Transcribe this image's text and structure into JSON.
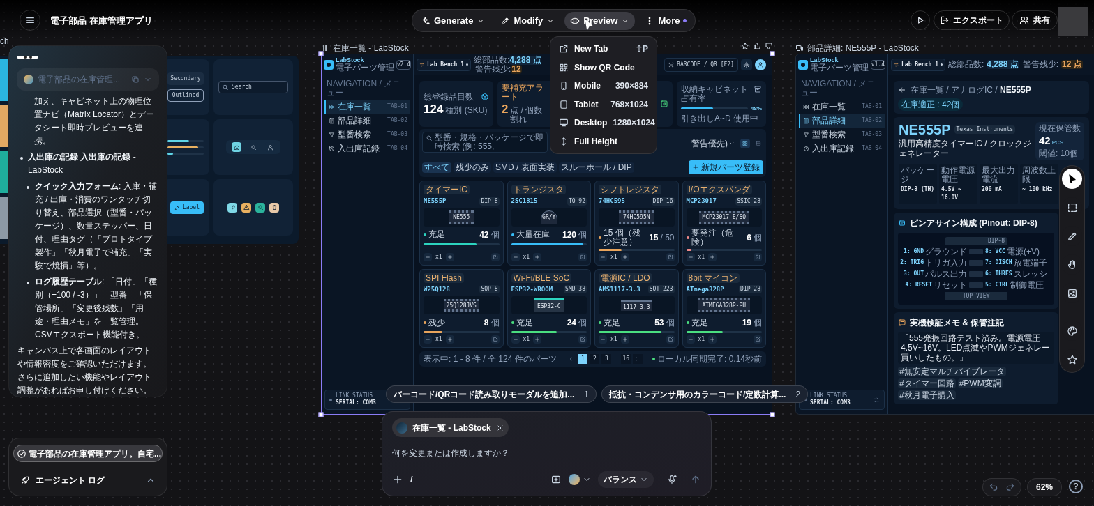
{
  "top_bar": {
    "title": "電子部品 在庫管理アプリ",
    "modes": [
      {
        "label": "Generate",
        "kind": "sparkle",
        "selected": false
      },
      {
        "label": "Modify",
        "kind": "pencil",
        "selected": false
      },
      {
        "label": "Preview",
        "kind": "eye",
        "selected": true
      },
      {
        "label": "More",
        "kind": "more",
        "selected": false
      }
    ],
    "export": "エクスポート",
    "share": "共有"
  },
  "preview_menu": [
    {
      "label": "New Tab",
      "kind": "new-tab",
      "shortcut": "⇧P"
    },
    {
      "label": "Show QR Code",
      "kind": "qr"
    },
    {
      "label": "Mobile",
      "kind": "mobile",
      "size": "390×884"
    },
    {
      "label": "Tablet",
      "kind": "tablet",
      "size": "768×1024"
    },
    {
      "label": "Desktop",
      "kind": "desktop",
      "size": "1280×1024"
    },
    {
      "label": "Full Height",
      "kind": "height"
    }
  ],
  "chat": {
    "collapsed_message": "電子部品の在庫管理...",
    "continuation": "加え、キャビネット上の物理位置ナビ（Matrix Locator）とデータシート即時プレビューを連携。",
    "bullets": [
      {
        "text": "**入出庫の記録 入出庫の記録** - LabStock",
        "children": [
          {
            "text": "**クイック入力フォーム**: 入庫・補充 / 出庫・消費のワンタッチ切り替え、部品選択（型番・パッケージ）、数量ステッパー、日付、理由タグ（「プロトタイプ製作」「秋月電子で補充」「実験で焼損」等）。"
          },
          {
            "text": "**ログ履歴テーブル**: 「日付」「種別（+100 / -3）」「型番」「保管場所」「変更後残数」「用途・理由メモ」を一覧管理。CSVエクスポート機能付き。"
          }
        ]
      }
    ],
    "closing": "キャンバス上で各画面のレイアウトや情報密度をご確認いただけます。さらに追加したい機能やレイアウト調整があればお申し付けください。"
  },
  "task": {
    "label": "電子部品の在庫管理アプリ。自宅..."
  },
  "agent_log": {
    "label": "エージェント ログ",
    "expanded": true
  },
  "design_frame": {
    "title": "ch",
    "swatches": [
      {
        "color": "#2bb5df"
      },
      {
        "color": "#e2a862"
      },
      {
        "color": "#1fae9c"
      },
      {
        "color": "#8d99a5"
      }
    ],
    "buttons": [
      "Secondary",
      "Outlined"
    ],
    "search_placeholder": "Search",
    "bars": [
      {
        "level": 0.6,
        "color": "#5fd4e6"
      },
      {
        "level": 0.85,
        "color": "#e8b060"
      },
      {
        "level": 0.15,
        "color": "#5fd4e6"
      }
    ],
    "nav": [
      {
        "kind": "home",
        "selected": true
      },
      {
        "kind": "search",
        "selected": false
      },
      {
        "kind": "user",
        "selected": false
      }
    ],
    "label_button": "Label",
    "chips": [
      {
        "kind": "tool",
        "color": "#7fd8e6"
      },
      {
        "kind": "warning",
        "color": "#e8b060"
      },
      {
        "kind": "search",
        "color": "#2bb39c"
      },
      {
        "kind": "trash",
        "color": "#e8c9a8"
      }
    ]
  },
  "inventory_frame": {
    "title": "在庫一覧 - LabStock",
    "selected": true,
    "brand": "LabStock",
    "subtitle": "電子パーツ管理",
    "version": "v2.4",
    "bench": "Lab Bench 1",
    "total_label": "総部品数:",
    "total": "4,288 点",
    "warn_label": "警告残少:",
    "warn": "12",
    "scanner": "BARCODE / QR [F2]",
    "nav_heading": "NAVIGATION / メニュー",
    "nav": [
      {
        "label": "在庫一覧",
        "code": "TAB-01",
        "kind": "grid",
        "selected": true
      },
      {
        "label": "部品詳細",
        "code": "TAB-02",
        "kind": "doc",
        "selected": false
      },
      {
        "label": "型番検索",
        "code": "TAB-03",
        "kind": "filter",
        "selected": false
      },
      {
        "label": "入出庫記録",
        "code": "TAB-04",
        "kind": "history",
        "selected": false
      }
    ],
    "link_label": "LINK STATUS",
    "link_value": "SERIAL: COM3",
    "stats": [
      {
        "kind": "count",
        "label": "総登録品目数",
        "value": "124",
        "unit": "種別 (SKU)"
      },
      {
        "kind": "alert",
        "label": "要補充アラート",
        "value": "2",
        "unit": "点 / 個数割れ"
      },
      {
        "kind": "hidden"
      },
      {
        "kind": "meter",
        "label": "収納キャビネット占有率",
        "value": "48%",
        "level": 0.48,
        "unit": "引き出しA~D 使用中"
      }
    ],
    "search_placeholder": "型番・規格・パッケージで即時検索 (例: 555,",
    "filters": [
      {
        "label": "すべて",
        "selected": true
      },
      {
        "label": "残少のみ",
        "selected": false
      },
      {
        "label": "SMD / 表面実装",
        "selected": false
      },
      {
        "label": "スルーホール / DIP",
        "selected": false
      }
    ],
    "sort": "警告優先)",
    "view": [
      {
        "kind": "grid",
        "selected": true
      },
      {
        "kind": "list",
        "selected": false
      }
    ],
    "new_button": "新規パーツ登録",
    "cards": [
      {
        "tag": "タイマーIC",
        "part": "NE555P",
        "package": "DIP-8",
        "kind": "dip",
        "marking": "NE555",
        "status": "充足",
        "count": "42",
        "unit": "個",
        "level": 0.7,
        "color": "#2dd4bf",
        "step": "x1"
      },
      {
        "tag": "トランジスタ",
        "part": "2SC1815",
        "package": "TO-92",
        "kind": "to92",
        "marking": "GR/Y",
        "status": "大量在庫",
        "count": "120",
        "unit": "個",
        "level": 0.95,
        "color": "#38bdf8",
        "step": "x1"
      },
      {
        "tag": "シフトレジスタ",
        "part": "74HC595",
        "package": "DIP-16",
        "kind": "dip",
        "marking": "74HC595N",
        "status": "15 個（残少注意）",
        "count": "15",
        "unit": "/ 50",
        "level": 0.3,
        "color": "#e8a45c",
        "step": "x1"
      },
      {
        "tag": "I/Oエクスパンダ",
        "part": "MCP23017",
        "package": "SSIC-28",
        "kind": "soic",
        "marking": "MCP23017-E/SO",
        "status": "要発注（危険）",
        "count": "6",
        "unit": "個",
        "level": 0.07,
        "color": "#f08a8a",
        "step": "x1"
      },
      {
        "tag": "SPI Flash",
        "part": "W25Q128",
        "package": "SOP-8",
        "kind": "soic",
        "marking": "25Q128JVS",
        "status": "残少",
        "count": "8",
        "unit": "個",
        "level": 0.25,
        "color": "#e8a45c",
        "step": "x1"
      },
      {
        "tag": "Wi-Fi/BLE SoC",
        "part": "ESP32-WROOM",
        "package": "SMD-38",
        "kind": "module",
        "marking": "ESP32-C",
        "status": "充足",
        "count": "24",
        "unit": "個",
        "level": 0.6,
        "color": "#4ade80",
        "step": "x1"
      },
      {
        "tag": "電源IC / LDO",
        "part": "AMS1117-3.3",
        "package": "SOT-223",
        "kind": "sot",
        "marking": "1117-3.3",
        "status": "充足",
        "count": "53",
        "unit": "個",
        "level": 0.83,
        "color": "#4ade80",
        "step": "x1"
      },
      {
        "tag": "8bit マイコン",
        "part": "ATmega328P",
        "package": "DIP-28",
        "kind": "dip",
        "marking": "ATMEGA328P-PU",
        "status": "充足",
        "count": "19",
        "unit": "個",
        "level": 0.48,
        "color": "#4ade80",
        "step": "x1"
      }
    ],
    "summary": "表示中: 1 - 8 件 / 全 124 件のパーツ",
    "pages": [
      {
        "label": "1",
        "kind": "page",
        "selected": true
      },
      {
        "label": "2",
        "kind": "page",
        "selected": false
      },
      {
        "label": "3",
        "kind": "page",
        "selected": false
      },
      {
        "label": "…",
        "kind": "gap"
      },
      {
        "label": "16",
        "kind": "page",
        "selected": false
      }
    ],
    "sync": "ローカル同期完了: 0.14秒前"
  },
  "detail_frame": {
    "title": "部品詳細: NE555P - LabStock",
    "selected": false,
    "brand": "LabStock",
    "subtitle": "電子パーツ管理",
    "version": "v1.4",
    "bench": "Lab Bench 1",
    "total_label": "総部品数:",
    "total": "4,288 点",
    "warn_label": "警告残少:",
    "warn": "12 点",
    "nav_heading": "NAVIGATION / メニュー",
    "nav": [
      {
        "label": "在庫一覧",
        "code": "TAB-01",
        "kind": "grid",
        "selected": false
      },
      {
        "label": "部品詳細",
        "code": "TAB-02",
        "kind": "doc",
        "selected": true
      },
      {
        "label": "型番検索",
        "code": "TAB-03",
        "kind": "filter",
        "selected": false
      },
      {
        "label": "入出庫記録",
        "code": "TAB-04",
        "kind": "history",
        "selected": false
      }
    ],
    "link_label": "LINK STATUS",
    "link_value": "SERIAL: COM3",
    "breadcrumb": "在庫一覧 / アナログIC / **NE555P**",
    "stock_badge": "在庫適正 : 42個",
    "part": "NE555P",
    "maker": "Texas Instruments",
    "description": "汎用高精度タイマーIC / クロックジェネレーター",
    "stock_label": "現在保管数",
    "stock": "42",
    "stock_unit": "PCS",
    "threshold": "閾値: 10個",
    "specs": [
      {
        "label": "パッケージ",
        "value": "DIP-8 (TH)"
      },
      {
        "label": "動作電源電圧",
        "value": "4.5V ~ 16.0V"
      },
      {
        "label": "最大出力電流",
        "value": "200 mA"
      },
      {
        "label": "周波数上限",
        "value": "~ 100 kHz"
      }
    ],
    "pinout_title": "ピンアサイン構成 (Pinout: DIP-8)",
    "chip_label": "DIP-8",
    "top_view": "TOP VIEW",
    "pins": [
      {
        "left": "1: GND",
        "left_note": "グラウンド",
        "right": "8: VCC",
        "right_note": "電源(+V)"
      },
      {
        "left": "2: TRIG",
        "left_note": "トリガ入力",
        "right": "7: DISCH",
        "right_note": "放電端子"
      },
      {
        "left": "3: OUT",
        "left_note": "パルス出力",
        "right": "6: THRES",
        "right_note": "スレッシ"
      },
      {
        "left": "4: RESET",
        "left_note": "リセット",
        "right": "5: CTRL",
        "right_note": "制御電圧"
      }
    ],
    "memo_title": "実機検証メモ & 保管注記",
    "memo": "「555発振回路テスト済み。電源電圧4.5V~16V。LED点滅やPWMジェネレー",
    "memo_end": "買いしたもの。」",
    "tags": [
      "#無安定マルチバイブレータ",
      "#タイマー回路",
      "#PWM変調",
      "#秋月電子購入"
    ]
  },
  "suggestions": [
    {
      "text": "バーコード/QRコード読み取りモーダルを追加...",
      "number": "1"
    },
    {
      "text": "抵抗・コンデンサ用のカラーコード/定数計算...",
      "number": "2"
    }
  ],
  "composer": {
    "context": "在庫一覧 - LabStock",
    "placeholder": "何を変更または作成しますか？",
    "command": "/",
    "mode": "バランス"
  },
  "tools": [
    {
      "kind": "select",
      "selected": true
    },
    {
      "kind": "marquee",
      "selected": false
    },
    {
      "kind": "pencil",
      "selected": false
    },
    {
      "kind": "hand",
      "selected": false
    },
    {
      "kind": "image",
      "selected": false
    },
    {
      "kind": "palette",
      "selected": false
    },
    {
      "kind": "star",
      "selected": false
    }
  ],
  "zoom": "62%",
  "help": "?"
}
